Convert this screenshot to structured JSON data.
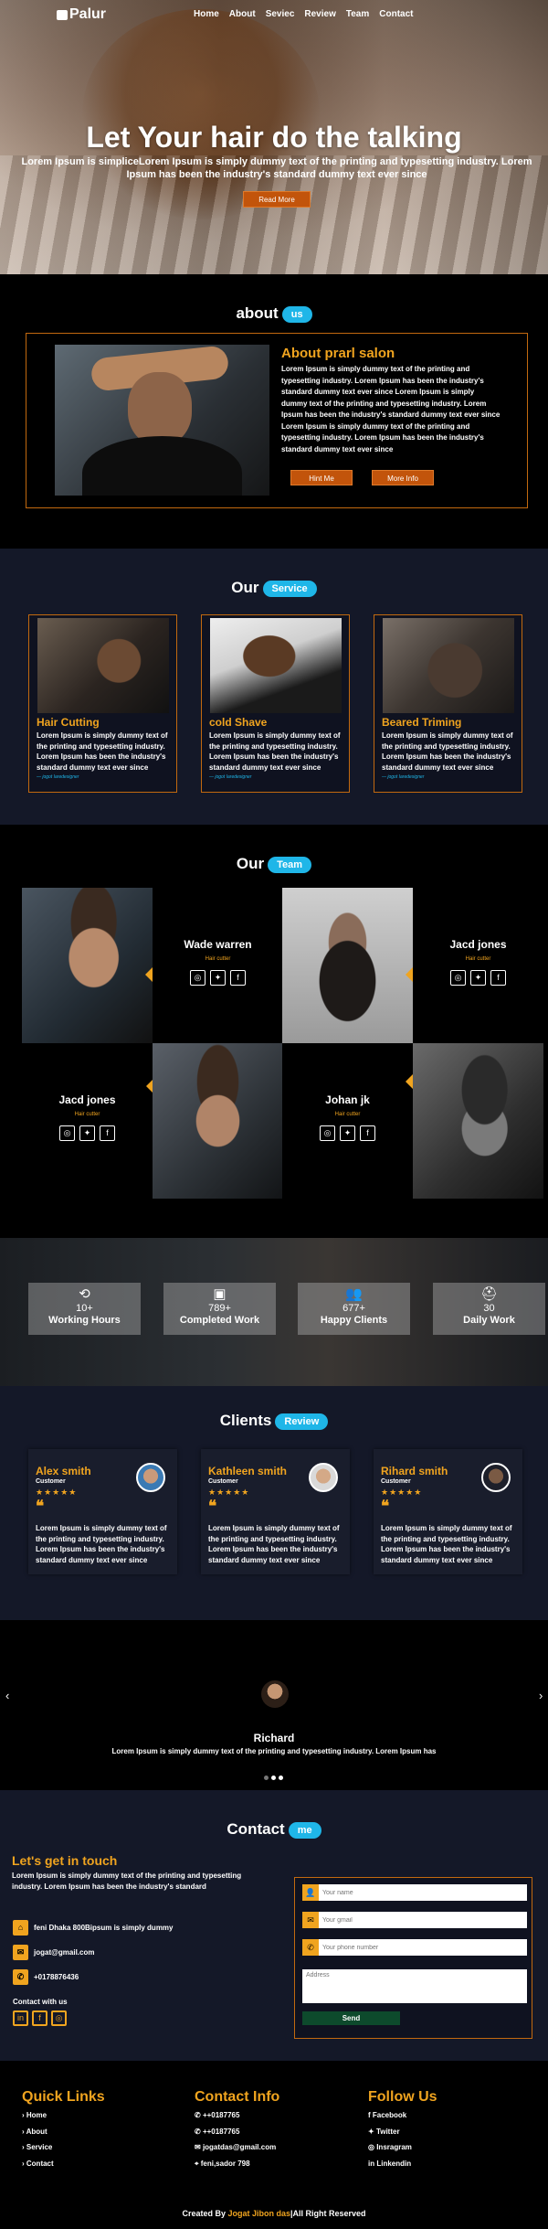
{
  "nav": {
    "logo": "Palur",
    "items": [
      "Home",
      "About",
      "Seviec",
      "Review",
      "Team",
      "Contact"
    ]
  },
  "hero": {
    "title": "Let Your hair do the talking",
    "subtitle": "Lorem Ipsum is simpliceLorem Ipsum is simply dummy text of the printing and typesetting industry. Lorem Ipsum has been the industry's standard dummy text ever since",
    "button": "Read More"
  },
  "about": {
    "heading": "about",
    "pill": "us",
    "title": "About prarl salon",
    "text": "Lorem Ipsum is simply dummy text of the printing and typesetting industry. Lorem Ipsum has been the industry's standard dummy text ever since Lorem Ipsum is simply dummy text of the printing and typesetting industry. Lorem Ipsum has been the industry's standard dummy text ever since Lorem Ipsum is simply dummy text of the printing and typesetting industry. Lorem Ipsum has been the industry's standard dummy text ever since",
    "btn1": "Hint Me",
    "btn2": "More Info"
  },
  "service": {
    "heading": "Our",
    "pill": "Service",
    "cards": [
      {
        "title": "Hair Cutting",
        "text": "Lorem Ipsum is simply dummy text of the printing and typesetting industry. Lorem Ipsum has been the industry's standard dummy text ever since",
        "by": "— jogot Iaredesigner"
      },
      {
        "title": "cold Shave",
        "text": "Lorem Ipsum is simply dummy text of the printing and typesetting industry. Lorem Ipsum has been the industry's standard dummy text ever since",
        "by": "— jogot Iaredesigner"
      },
      {
        "title": "Beared Triming",
        "text": "Lorem Ipsum is simply dummy text of the printing and typesetting industry. Lorem Ipsum has been the industry's standard dummy text ever since",
        "by": "— jogot Iaredesigner"
      }
    ]
  },
  "team": {
    "heading": "Our",
    "pill": "Team",
    "members": [
      {
        "name": "Wade warren",
        "role": "Hair cutter"
      },
      {
        "name": "Jacd jones",
        "role": "Hair cutter"
      },
      {
        "name": "Jacd jones",
        "role": "Hair cutter"
      },
      {
        "name": "Johan jk",
        "role": "Hair cutter"
      }
    ]
  },
  "stats": [
    {
      "icon": "history-icon",
      "number": "10+",
      "label": "Working Hours"
    },
    {
      "icon": "gift-icon",
      "number": "789+",
      "label": "Completed Work"
    },
    {
      "icon": "users-icon",
      "number": "677+",
      "label": "Happy Clients"
    },
    {
      "icon": "worker-icon",
      "number": "30",
      "label": "Daily Work"
    }
  ],
  "clients": {
    "heading": "Clients",
    "pill": "Review",
    "reviews": [
      {
        "name": "Alex smith",
        "type": "Customer",
        "stars": "★★★★★",
        "text": "Lorem Ipsum is simply dummy text of the printing and typesetting industry. Lorem Ipsum has been the industry's standard dummy text ever since",
        "rating": 4.5
      },
      {
        "name": "Kathleen smith",
        "type": "Customer",
        "stars": "★★★★★",
        "text": "Lorem Ipsum is simply dummy text of the printing and typesetting industry. Lorem Ipsum has been the industry's standard dummy text ever since",
        "rating": 4.5
      },
      {
        "name": "Rihard smith",
        "type": "Customer",
        "stars": "★★★★★",
        "text": "Lorem Ipsum is simply dummy text of the printing and typesetting industry. Lorem Ipsum has been the industry's standard dummy text ever since",
        "rating": 4.5
      }
    ]
  },
  "testimonial": {
    "name": "Richard",
    "text": "Lorem Ipsum is simply dummy text of the printing and typesetting industry. Lorem Ipsum has",
    "prev": "‹",
    "next": "›"
  },
  "contact": {
    "heading": "Contact",
    "pill": "me",
    "title": "Let's get in touch",
    "text": "Lorem Ipsum is simply dummy text of the printing and typesetting industry. Lorem Ipsum has been the industry's standard",
    "address": "feni Dhaka 800Bipsum is simply dummy",
    "email": "jogat@gmail.com",
    "phone": "+0178876436",
    "with": "Contact with us",
    "form": {
      "name_ph": "Your name",
      "email_ph": "Your gmail",
      "phone_ph": "Your phone number",
      "address_ph": "Address",
      "send": "Send"
    }
  },
  "footer": {
    "quick": {
      "title": "Quick Links",
      "items": [
        "Home",
        "About",
        "Service",
        "Contact"
      ]
    },
    "info": {
      "title": "Contact Info",
      "items": [
        "++0187765",
        "++0187765",
        "jogatdas@gmail.com",
        "feni,sador 798"
      ]
    },
    "follow": {
      "title": "Follow Us",
      "items": [
        "Facebook",
        "Twitter",
        "Insragram",
        "Linkendin"
      ]
    },
    "copy_a": "Created By ",
    "copy_b": "Jogat Jibon das",
    "copy_c": "|All Right Reserved"
  },
  "colors": {
    "accent": "#f0a41f",
    "pill": "#1fb6e8",
    "button": "#c2540b",
    "border": "#c2690f",
    "section_bg": "#141828"
  }
}
